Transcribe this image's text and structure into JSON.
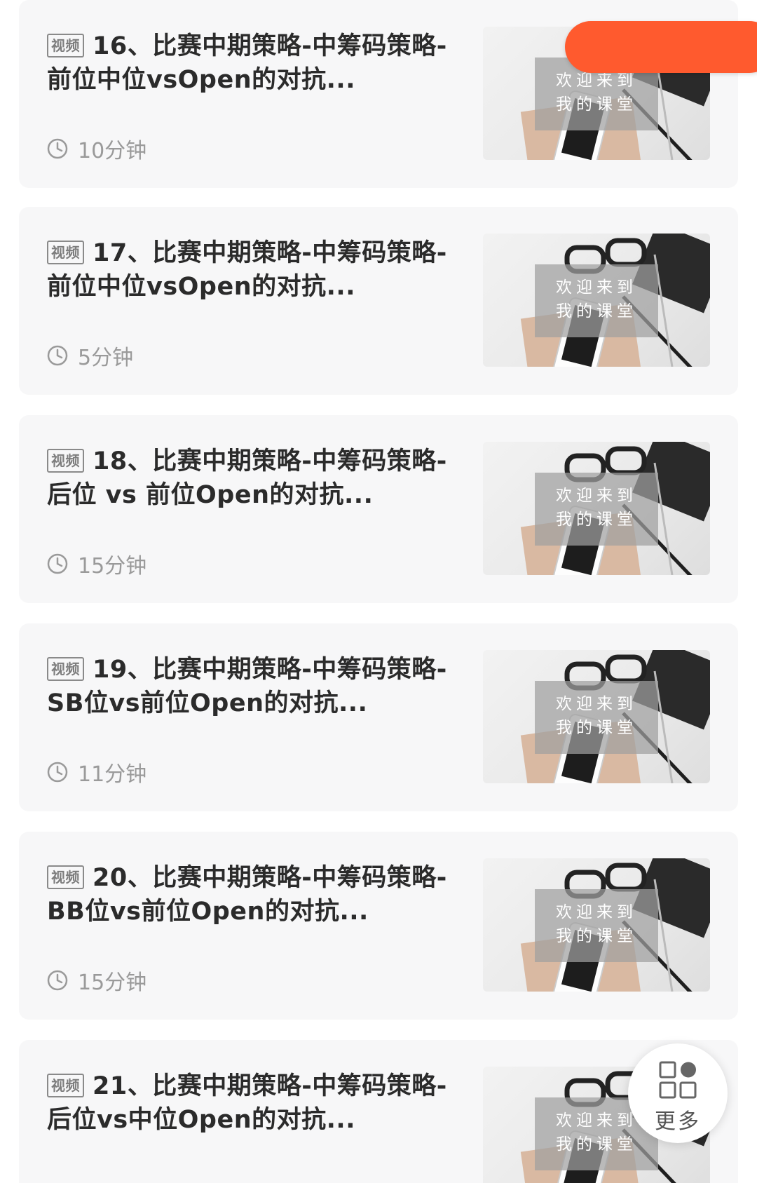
{
  "lessons": [
    {
      "tag": "视频",
      "title": "16、比赛中期策略-中筹码策略-前位中位vsOpen的对抗...",
      "duration": "10分钟",
      "thumbnail_line1": "欢迎来到",
      "thumbnail_line2": "我的课堂"
    },
    {
      "tag": "视频",
      "title": "17、比赛中期策略-中筹码策略-前位中位vsOpen的对抗...",
      "duration": "5分钟",
      "thumbnail_line1": "欢迎来到",
      "thumbnail_line2": "我的课堂"
    },
    {
      "tag": "视频",
      "title": "18、比赛中期策略-中筹码策略-后位 vs 前位Open的对抗...",
      "duration": "15分钟",
      "thumbnail_line1": "欢迎来到",
      "thumbnail_line2": "我的课堂"
    },
    {
      "tag": "视频",
      "title": "19、比赛中期策略-中筹码策略-SB位vs前位Open的对抗...",
      "duration": "11分钟",
      "thumbnail_line1": "欢迎来到",
      "thumbnail_line2": "我的课堂"
    },
    {
      "tag": "视频",
      "title": "20、比赛中期策略-中筹码策略-BB位vs前位Open的对抗...",
      "duration": "15分钟",
      "thumbnail_line1": "欢迎来到",
      "thumbnail_line2": "我的课堂"
    },
    {
      "tag": "视频",
      "title": "21、比赛中期策略-中筹码策略-后位vs中位Open的对抗...",
      "duration": "",
      "thumbnail_line1": "欢迎来到",
      "thumbnail_line2": "我的课堂"
    }
  ],
  "floating": {
    "more_label": "更多",
    "more_icon": "grid-apps-icon"
  },
  "colors": {
    "accent_orange": "#ff5a2e",
    "card_background": "#f7f7f8",
    "title_text": "#2b2b2b",
    "meta_text": "#9a9a9a"
  }
}
